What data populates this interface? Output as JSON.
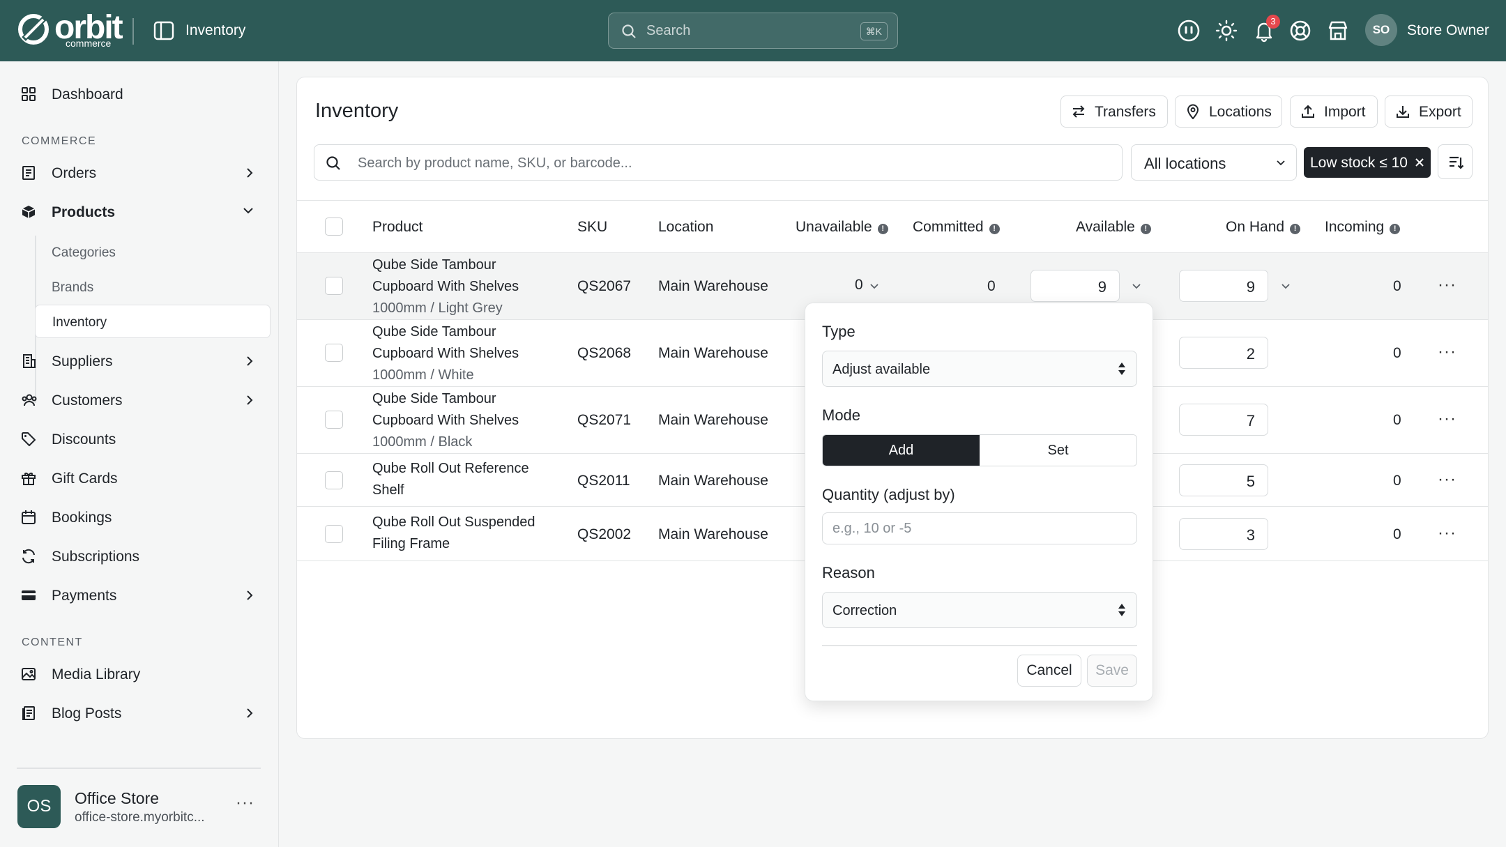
{
  "topbar": {
    "logo": "orbit",
    "logo_sub": "commerce",
    "page": "Inventory",
    "search_placeholder": "Search",
    "search_shortcut": "⌘K",
    "notification_count": "3",
    "user_initials": "SO",
    "user_name": "Store Owner"
  },
  "sidebar": {
    "dashboard": "Dashboard",
    "section_commerce": "COMMERCE",
    "orders": "Orders",
    "products": "Products",
    "sub": {
      "categories": "Categories",
      "brands": "Brands",
      "inventory": "Inventory"
    },
    "suppliers": "Suppliers",
    "customers": "Customers",
    "discounts": "Discounts",
    "gift_cards": "Gift Cards",
    "bookings": "Bookings",
    "subscriptions": "Subscriptions",
    "payments": "Payments",
    "section_content": "CONTENT",
    "media_library": "Media Library",
    "blog_posts": "Blog Posts",
    "store": {
      "initials": "OS",
      "name": "Office Store",
      "url": "office-store.myorbitc..."
    }
  },
  "inventory": {
    "title": "Inventory",
    "buttons": {
      "transfers": "Transfers",
      "locations": "Locations",
      "import": "Import",
      "export": "Export"
    },
    "search_placeholder": "Search by product name, SKU, or barcode...",
    "location_filter": "All locations",
    "chip": "Low stock ≤ 10",
    "columns": {
      "product": "Product",
      "sku": "SKU",
      "location": "Location",
      "unavailable": "Unavailable",
      "committed": "Committed",
      "available": "Available",
      "on_hand": "On Hand",
      "incoming": "Incoming"
    },
    "rows": [
      {
        "name": "Qube Side Tambour Cupboard With Shelves",
        "variant": "1000mm / Light Grey",
        "sku": "QS2067",
        "location": "Main Warehouse",
        "unavailable": "0",
        "committed": "0",
        "available": "9",
        "on_hand": "9",
        "incoming": "0"
      },
      {
        "name": "Qube Side Tambour Cupboard With Shelves",
        "variant": "1000mm / White",
        "sku": "QS2068",
        "location": "Main Warehouse",
        "on_hand": "2",
        "incoming": "0"
      },
      {
        "name": "Qube Side Tambour Cupboard With Shelves",
        "variant": "1000mm / Black",
        "sku": "QS2071",
        "location": "Main Warehouse",
        "on_hand": "7",
        "incoming": "0"
      },
      {
        "name": "Qube Roll Out Reference Shelf",
        "sku": "QS2011",
        "location": "Main Warehouse",
        "on_hand": "5",
        "incoming": "0"
      },
      {
        "name": "Qube Roll Out Suspended Filing Frame",
        "sku": "QS2002",
        "location": "Main Warehouse",
        "on_hand": "3",
        "incoming": "0"
      }
    ]
  },
  "popover": {
    "type_label": "Type",
    "type_value": "Adjust available",
    "mode_label": "Mode",
    "mode_add": "Add",
    "mode_set": "Set",
    "quantity_label": "Quantity (adjust by)",
    "quantity_placeholder": "e.g., 10 or -5",
    "reason_label": "Reason",
    "reason_value": "Correction",
    "cancel": "Cancel",
    "save": "Save"
  },
  "colors": {
    "topbar": "#2d5a57",
    "accent_dark": "#1f2328",
    "badge": "#e5484d"
  }
}
